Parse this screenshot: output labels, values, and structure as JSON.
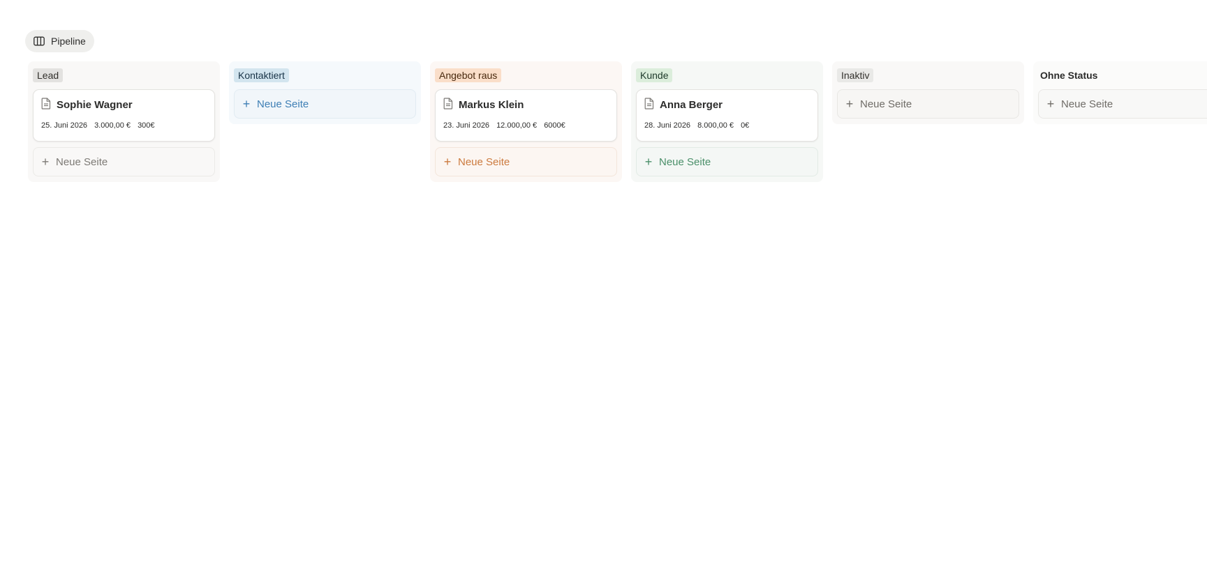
{
  "view": {
    "tab_label": "Pipeline",
    "tab_icon": "board-columns-icon"
  },
  "columns": [
    {
      "status": "Lead",
      "pill_bg": "#e3e2e0",
      "pill_fg": "#32302c",
      "col_bg": "#f9f8f7",
      "cards": [
        {
          "title": "Sophie Wagner",
          "date": "25. Juni 2026",
          "amount": "3.000,00 €",
          "extra": "300€"
        }
      ],
      "add_label": "Neue Seite",
      "add_fg": "#7d7a75",
      "add_bg": "#f9f8f7",
      "add_border": "#ebeae7"
    },
    {
      "status": "Kontaktiert",
      "pill_bg": "#d3e5ef",
      "pill_fg": "#183347",
      "col_bg": "#f5f9fc",
      "cards": [],
      "add_label": "Neue Seite",
      "add_fg": "#3e7fb5",
      "add_bg": "#f1f6fa",
      "add_border": "#e1ebf2"
    },
    {
      "status": "Angebot raus",
      "pill_bg": "#fadec9",
      "pill_fg": "#49290e",
      "col_bg": "#fcf7f4",
      "cards": [
        {
          "title": "Markus Klein",
          "date": "23. Juni 2026",
          "amount": "12.000,00 €",
          "extra": "6000€"
        }
      ],
      "add_label": "Neue Seite",
      "add_fg": "#cc7a3e",
      "add_bg": "#fcf6f2",
      "add_border": "#f3e5da"
    },
    {
      "status": "Kunde",
      "pill_bg": "#dbeddb",
      "pill_fg": "#1c3829",
      "col_bg": "#f6f8f6",
      "cards": [
        {
          "title": "Anna Berger",
          "date": "28. Juni 2026",
          "amount": "8.000,00 €",
          "extra": "0€"
        }
      ],
      "add_label": "Neue Seite",
      "add_fg": "#4a8f69",
      "add_bg": "#f4f7f5",
      "add_border": "#e2ebe5"
    },
    {
      "status": "Inaktiv",
      "pill_bg": "#e9e9e7",
      "pill_fg": "#32302c",
      "col_bg": "#f9f8f7",
      "cards": [],
      "add_label": "Neue Seite",
      "add_fg": "#6f6c67",
      "add_bg": "#f7f6f4",
      "add_border": "#e8e7e4"
    },
    {
      "status": "Ohne Status",
      "pill_bg": "transparent",
      "pill_fg": "#2c2c2b",
      "col_bg": "#fbfbfa",
      "cards": [],
      "add_label": "Neue Seite",
      "add_fg": "#6f6c67",
      "add_bg": "#f8f8f7",
      "add_border": "#e8e7e4"
    }
  ]
}
